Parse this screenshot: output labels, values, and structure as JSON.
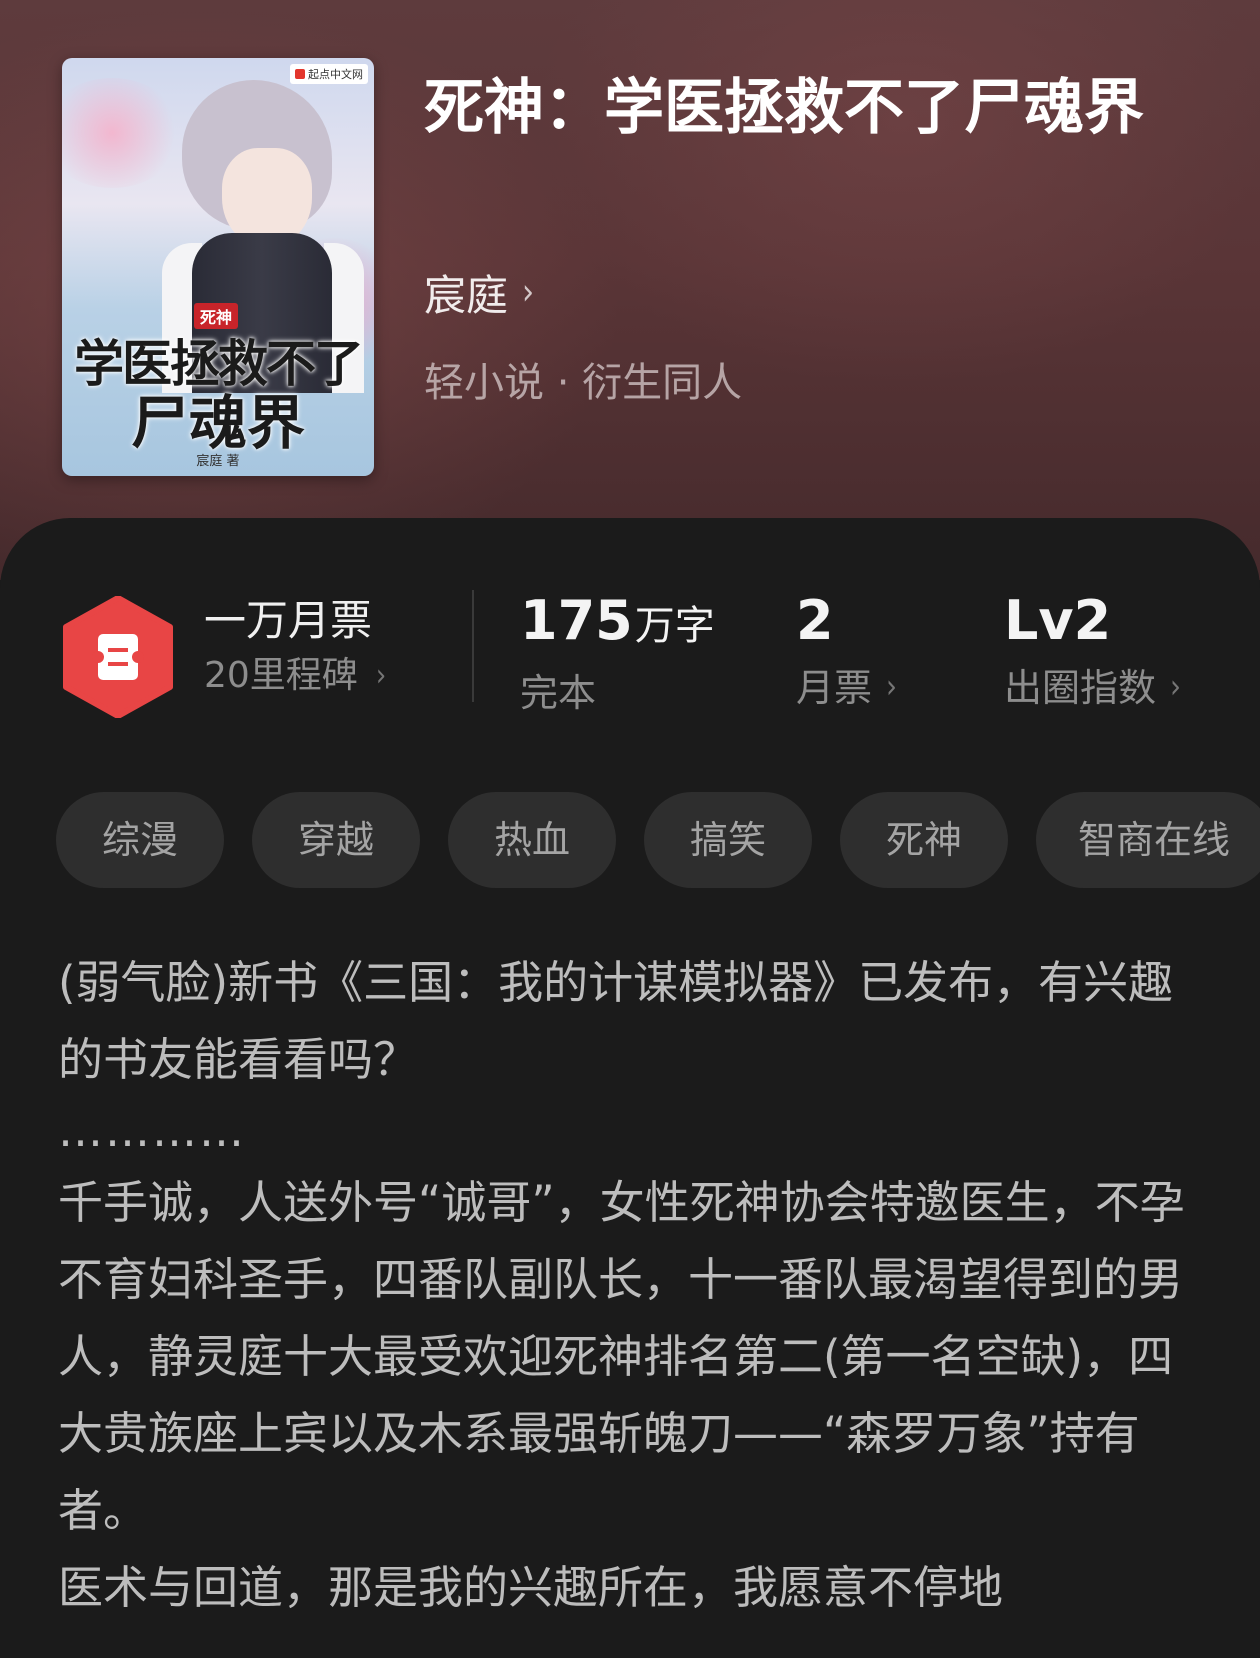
{
  "book": {
    "title": "死神：学医拯救不了尸魂界",
    "author": "宸庭",
    "category": "轻小说 · 衍生同人",
    "cover": {
      "publisher": "起点中文网",
      "tag": "死神",
      "line1": "学医拯救不了",
      "line2": "尸魂界",
      "author": "宸庭 著"
    }
  },
  "stats": {
    "award_title": "一万月票",
    "award_sub": "20里程碑",
    "words_value": "175",
    "words_unit": "万字",
    "status": "完本",
    "monthly_value": "2",
    "monthly_label": "月票",
    "index_value": "Lv2",
    "index_label": "出圈指数"
  },
  "tags": [
    "综漫",
    "穿越",
    "热血",
    "搞笑",
    "死神",
    "智商在线"
  ],
  "description": {
    "line1": "(弱气脸)新书《三国：我的计谋模拟器》已发布，有兴趣的书友能看看吗？",
    "dots": "…………",
    "para2": "千手诚，人送外号“诚哥”，女性死神协会特邀医生，不孕不育妇科圣手，四番队副队长，十一番队最渴望得到的男人，静灵庭十大最受欢迎死神排名第二(第一名空缺)，四大贵族座上宾以及木系最强斩魄刀——“森罗万象”持有者。",
    "para3": "医术与回道，那是我的兴趣所在，我愿意不停地"
  },
  "colors": {
    "badge_red": "#e84545",
    "panel_bg": "#1b1b1b",
    "tag_bg": "#2e2e2e"
  }
}
